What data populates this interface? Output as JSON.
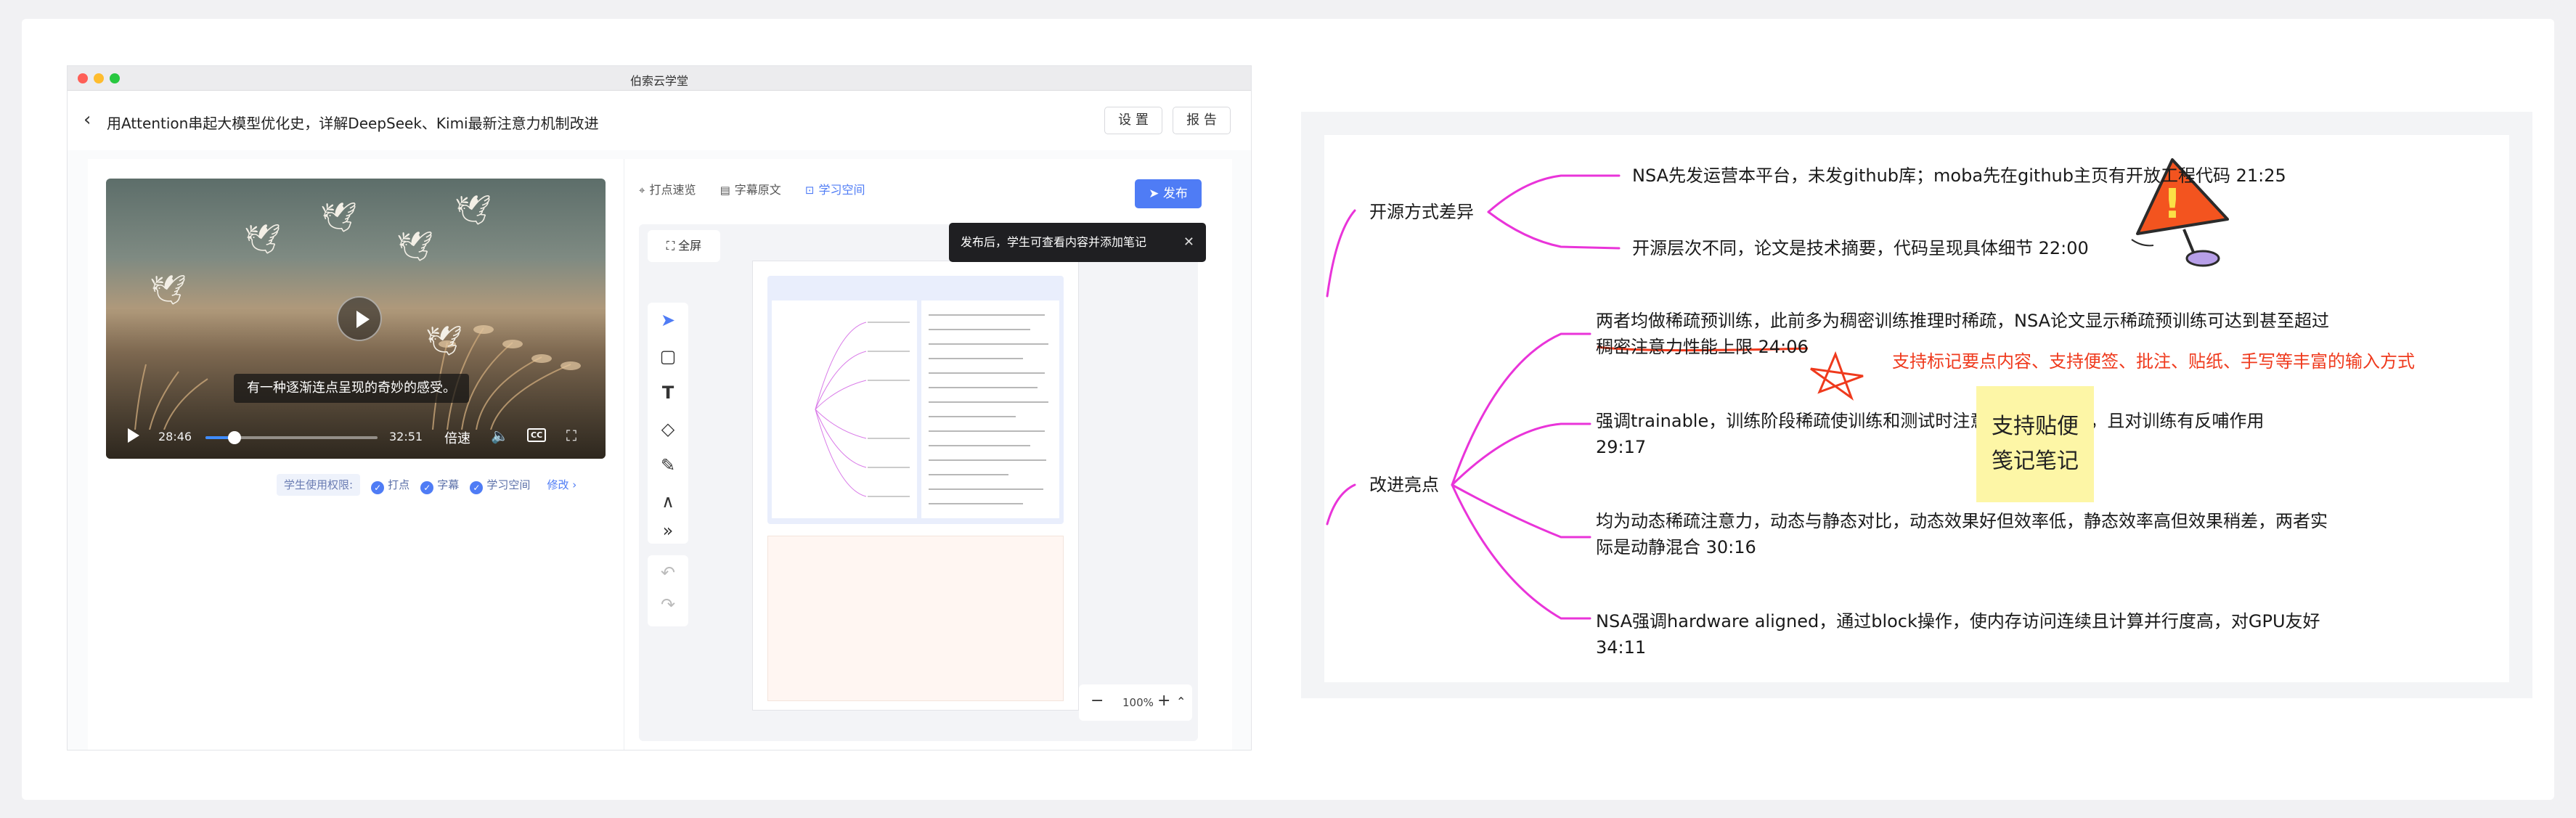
{
  "window": {
    "title": "伯索云学堂",
    "course_title": "用Attention串起大模型优化史，详解DeepSeek、Kimi最新注意力机制改进",
    "btn_settings": "设 置",
    "btn_report": "报 告"
  },
  "video": {
    "subtitle": "有一种逐渐连点呈现的奇妙的感受。",
    "current_time": "28:46",
    "total_time": "32:51",
    "speed_label": "倍速",
    "progress": 0.167
  },
  "permissions": {
    "label": "学生使用权限:",
    "items": [
      "打点",
      "字幕",
      "学习空间"
    ],
    "edit": "修改"
  },
  "tabs": [
    "打点速览",
    "字幕原文",
    "学习空间"
  ],
  "publish_label": "发布",
  "tooltip": "发布后，学生可查看内容并添加笔记",
  "fullscreen_label": "全屏",
  "zoom": "100%",
  "mindmap": {
    "branches": [
      {
        "label": "开源方式差异",
        "leaves": [
          "NSA先发运营本平台，未发github库；moba先在github主页有开放工程代码 21:25",
          "开源层次不同，论文是技术摘要，代码呈现具体细节 22:00"
        ]
      },
      {
        "label": "改进亮点",
        "leaves": [
          "两者均做稀疏预训练，此前多为稠密训练推理时稀疏，NSA论文显示稀疏预训练可达到甚至超过",
          "稠密注意力性能上限 24:06",
          "强调trainable，训练阶段稀疏使训练和测试时注意力模式无gap，且对训练有反哺作用",
          "29:17",
          "均为动态稀疏注意力，动态与静态对比，动态效果好但效率低，静态效率高但效果稍差，两者实",
          "际是动静混合 30:16",
          "NSA强调hardware aligned，通过block操作，使内存访问连续且计算并行度高，对GPU友好",
          "34:11"
        ]
      }
    ],
    "annotation": "支持标记要点内容、支持便签、批注、贴纸、手写等丰富的输入方式",
    "sticky_note": [
      "支持贴便",
      "笺记笔记"
    ]
  },
  "colors": {
    "accent": "#4f7cf5",
    "branch": "#e934d9",
    "annotation": "#ef3a1d",
    "sticky": "#fdf6a6"
  }
}
